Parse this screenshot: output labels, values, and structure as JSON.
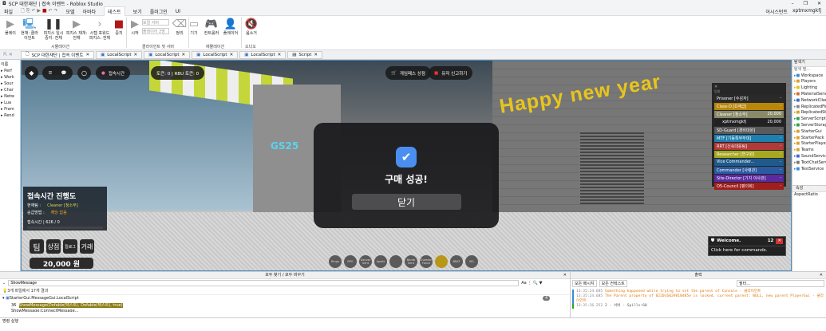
{
  "window": {
    "title": "SCP 대한재단 | 접속 이벤트 - Roblox Studio",
    "minimize": "–",
    "maximize": "❐",
    "close": "✕"
  },
  "menu": {
    "items": [
      "파일",
      "모델",
      "아바타",
      "테스트",
      "보기",
      "플러그인",
      "UI"
    ],
    "active": "테스트",
    "assistant": "어시스턴트",
    "user": "xptmxmgkfj"
  },
  "ribbon": {
    "buttons": [
      {
        "label": "플레이",
        "icon": "▶"
      },
      {
        "label": "현재: 클라이언트",
        "icon": "🖳"
      },
      {
        "label": "피지스 일시 중지: 전체",
        "icon": "❚❚"
      },
      {
        "label": "피지스 재개: 전체",
        "icon": "▶"
      },
      {
        "label": "스텝 포워드 피지스: 전체",
        "icon": "›"
      },
      {
        "label": "중지",
        "icon": "■"
      },
      {
        "label": "시작",
        "icon": "▶"
      },
      {
        "label": "정리",
        "icon": "⌫"
      },
      {
        "label": "기기",
        "icon": "▭"
      },
      {
        "label": "컨트롤러",
        "icon": "🎮"
      },
      {
        "label": "플레이어",
        "icon": "👤"
      },
      {
        "label": "음소거",
        "icon": "🔇"
      }
    ],
    "dropdowns": [
      "로컬 서버",
      "플레이어 2명"
    ],
    "groups": [
      "시뮬레이션",
      "클라이언트 및 서버",
      "에뮬레이션",
      "오디오"
    ]
  },
  "tabs": [
    {
      "label": "SCP 대한재단 | 접속 이벤트"
    },
    {
      "label": "LocalScript"
    },
    {
      "label": "LocalScript"
    },
    {
      "label": "LocalScript"
    },
    {
      "label": "LocalScript"
    },
    {
      "label": "Script"
    }
  ],
  "explorer_left": {
    "title": "이름",
    "items": [
      "Perf",
      "Work",
      "Sour",
      "Char",
      "Netw",
      "Lua",
      "Fram",
      "Rend"
    ]
  },
  "game": {
    "playtime_btn": "접속시간",
    "currency": "토큰: 0 | RBU 토큰: 0",
    "shop_btn": "게임패스 상점",
    "report_btn": "유저 신고하기",
    "sign": "Happy new year",
    "store": "GS25",
    "modal": {
      "title": "구매 성공!",
      "close": "닫기"
    },
    "progress": {
      "title": "접속시간 진행도",
      "team_label": "현재팀 :",
      "team_value": "Cleaner [청소부]",
      "promo_label": "승급방법 :",
      "promo_value": "해당 없음",
      "time": "접속시간 | 626 / 0",
      "fraction": 0
    },
    "buttons": [
      "팀",
      "상점",
      "킬로그",
      "거래"
    ],
    "money": "20,000 원",
    "teams": {
      "header": "팀원",
      "rows": [
        {
          "name": "Prisoner [수감자]",
          "value": "-",
          "color": "#2a2a2a"
        },
        {
          "name": "Class-D [D계급]",
          "value": "-",
          "color": "#b8860b"
        },
        {
          "name": "Cleaner [청소부]",
          "value": "20,000",
          "color": "#8a8a6a"
        },
        {
          "name": "xptmxmgkfj",
          "value": "20,000",
          "color": "#222222"
        },
        {
          "name": "SD-Guard [경비대원]",
          "value": "-",
          "color": "#5a5a5a"
        },
        {
          "name": "MTF [기동특무부대]",
          "value": "-",
          "color": "#1e7fb0"
        },
        {
          "name": "RRT [신속대응팀]",
          "value": "-",
          "color": "#b03a3a"
        },
        {
          "name": "Researcher [연구원]",
          "value": "-",
          "color": "#a8a81e"
        },
        {
          "name": "Vice Commander...",
          "value": "-",
          "color": "#1f5a8a"
        },
        {
          "name": "Commander [사령관]",
          "value": "-",
          "color": "#2a5aa0"
        },
        {
          "name": "Site-Director [기지 이사관]",
          "value": "-",
          "color": "#5a2aa0"
        },
        {
          "name": "O5-Council [평의회]",
          "value": "-",
          "color": "#a01e1e"
        }
      ]
    },
    "welcome": {
      "title": "Welcome.",
      "count": "12",
      "body": "Click here for commands."
    },
    "hotbar": [
      "Ringu",
      "RPG",
      "Denver Sent",
      "Apollo",
      "",
      "Bomb Sent",
      "Chamber Fonce",
      "",
      "BRAT",
      "VEL"
    ]
  },
  "explorer_right": {
    "title": "탐색기",
    "filter": "탐색 필...",
    "items": [
      "Workspace",
      "Players",
      "Lighting",
      "MaterialService",
      "NetworkClient",
      "ReplicatedFirst",
      "ReplicatedStorage",
      "ServerScriptService",
      "ServerStorage",
      "StarterGui",
      "StarterPack",
      "StarterPlayer",
      "Teams",
      "SoundService",
      "TextChatService",
      "TestService"
    ],
    "props_title": "속성",
    "prop": "AspectRatio"
  },
  "find": {
    "title": "모두 찾기 / 모두 바꾸기",
    "query": "ShowMessage",
    "summary": "3개 파일에서 17개 결과",
    "file": "StarterGui.MessageGui.LocalScript",
    "line_no": "36",
    "line": "ShowMessage(Dofable(텍스트), Dofable(텍스트), true)",
    "line2": "ShowMessage:ConnectMessage...",
    "count": "4"
  },
  "output": {
    "title": "출력",
    "filter1": "모든 메시지",
    "filter2": "모든 컨텍스트",
    "search": "필터...",
    "lines": [
      {
        "time": "13:35:24.685",
        "text": "Something happened while trying to set the parent of Console  -  클라이언트"
      },
      {
        "time": "13:35:24.685",
        "text": "The Parent property of 0220c6029818d85e is locked, current parent: NULL, new parent PlayerGui  -  클라이언트"
      },
      {
        "time": "13:35:26.252",
        "text": "2  -  서버 - Spills:60"
      }
    ]
  },
  "command": {
    "placeholder": "명령 실행"
  }
}
